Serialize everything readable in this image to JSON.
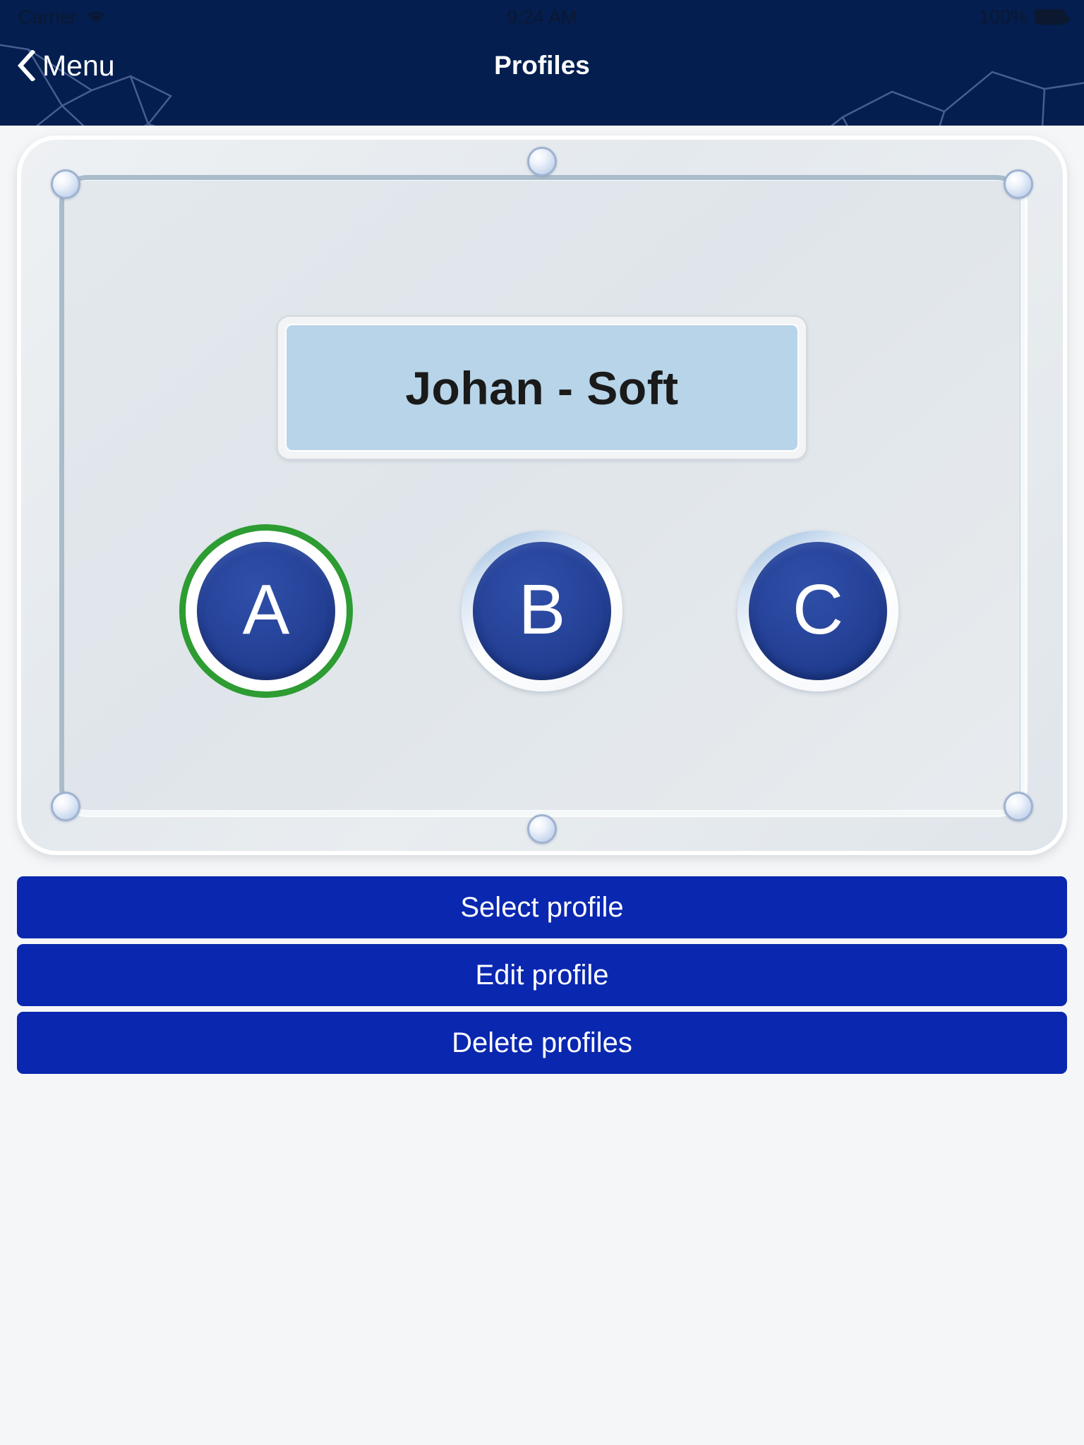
{
  "status_bar": {
    "carrier": "Carrier",
    "wifi_icon": "wifi-icon",
    "time": "9:24 AM",
    "battery_percent": "100%",
    "battery_icon": "battery-full-icon"
  },
  "navbar": {
    "back_label": "Menu",
    "back_icon": "chevron-left-icon",
    "title": "Profiles"
  },
  "profile_card": {
    "name": "Johan - Soft",
    "slots": [
      {
        "letter": "A",
        "selected": true
      },
      {
        "letter": "B",
        "selected": false
      },
      {
        "letter": "C",
        "selected": false
      }
    ]
  },
  "actions": {
    "select_profile": "Select profile",
    "edit_profile": "Edit profile",
    "delete_profiles": "Delete profiles"
  },
  "colors": {
    "header_navy": "#041e4f",
    "button_blue": "#0a27b0",
    "slot_blue": "#27449b",
    "selected_green": "#2d9c32",
    "name_field_blue": "#b7d4e8",
    "page_background": "#f5f6f7"
  }
}
